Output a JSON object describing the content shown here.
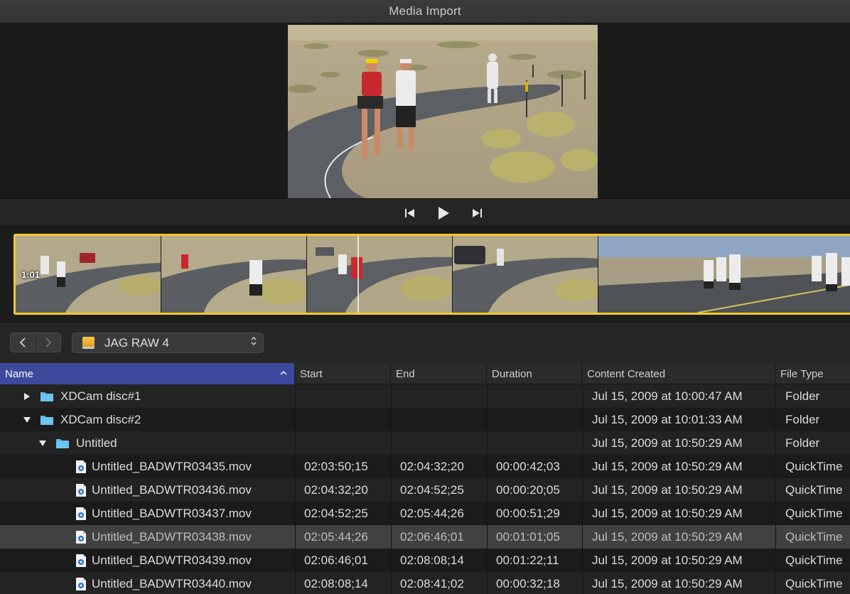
{
  "window": {
    "title": "Media Import"
  },
  "viewer": {
    "preview_image": "runners-on-desert-road"
  },
  "transport": {
    "prev_icon": "skip-back-icon",
    "play_icon": "play-icon",
    "next_icon": "skip-forward-icon"
  },
  "filmstrip": {
    "timecode": "1:01",
    "highlight_color": "#f2c92b"
  },
  "nav": {
    "back_icon": "chevron-left-icon",
    "forward_icon": "chevron-right-icon",
    "device_name": "JAG RAW 4"
  },
  "table": {
    "columns": [
      {
        "label": "Name",
        "sorted": true
      },
      {
        "label": "Start"
      },
      {
        "label": "End"
      },
      {
        "label": "Duration"
      },
      {
        "label": "Content Created"
      },
      {
        "label": "File Type"
      }
    ],
    "rows": [
      {
        "kind": "folder",
        "depth": 0,
        "expanded": false,
        "name": "XDCam disc#1",
        "start": "",
        "end": "",
        "duration": "",
        "created": "Jul 15, 2009 at 10:00:47 AM",
        "type": "Folder"
      },
      {
        "kind": "folder",
        "depth": 0,
        "expanded": true,
        "name": "XDCam disc#2",
        "start": "",
        "end": "",
        "duration": "",
        "created": "Jul 15, 2009 at 10:01:33 AM",
        "type": "Folder"
      },
      {
        "kind": "folder",
        "depth": 1,
        "expanded": true,
        "name": "Untitled",
        "start": "",
        "end": "",
        "duration": "",
        "created": "Jul 15, 2009 at 10:50:29 AM",
        "type": "Folder"
      },
      {
        "kind": "file",
        "depth": 2,
        "name": "Untitled_BADWTR03435.mov",
        "start": "02:03:50;15",
        "end": "02:04:32;20",
        "duration": "00:00:42;03",
        "created": "Jul 15, 2009 at 10:50:29 AM",
        "type": "QuickTime"
      },
      {
        "kind": "file",
        "depth": 2,
        "name": "Untitled_BADWTR03436.mov",
        "start": "02:04:32;20",
        "end": "02:04:52;25",
        "duration": "00:00:20;05",
        "created": "Jul 15, 2009 at 10:50:29 AM",
        "type": "QuickTime"
      },
      {
        "kind": "file",
        "depth": 2,
        "name": "Untitled_BADWTR03437.mov",
        "start": "02:04:52;25",
        "end": "02:05:44;26",
        "duration": "00:00:51;29",
        "created": "Jul 15, 2009 at 10:50:29 AM",
        "type": "QuickTime"
      },
      {
        "kind": "file",
        "depth": 2,
        "selected": true,
        "name": "Untitled_BADWTR03438.mov",
        "start": "02:05:44;26",
        "end": "02:06:46;01",
        "duration": "00:01:01;05",
        "created": "Jul 15, 2009 at 10:50:29 AM",
        "type": "QuickTime"
      },
      {
        "kind": "file",
        "depth": 2,
        "name": "Untitled_BADWTR03439.mov",
        "start": "02:06:46;01",
        "end": "02:08:08;14",
        "duration": "00:01:22;11",
        "created": "Jul 15, 2009 at 10:50:29 AM",
        "type": "QuickTime"
      },
      {
        "kind": "file",
        "depth": 2,
        "name": "Untitled_BADWTR03440.mov",
        "start": "02:08:08;14",
        "end": "02:08:41;02",
        "duration": "00:00:32;18",
        "created": "Jul 15, 2009 at 10:50:29 AM",
        "type": "QuickTime"
      }
    ]
  },
  "colors": {
    "sort_header": "#3b4a9c",
    "folder_icon": "#5fb8ea",
    "accent_yellow": "#f2c92b"
  }
}
